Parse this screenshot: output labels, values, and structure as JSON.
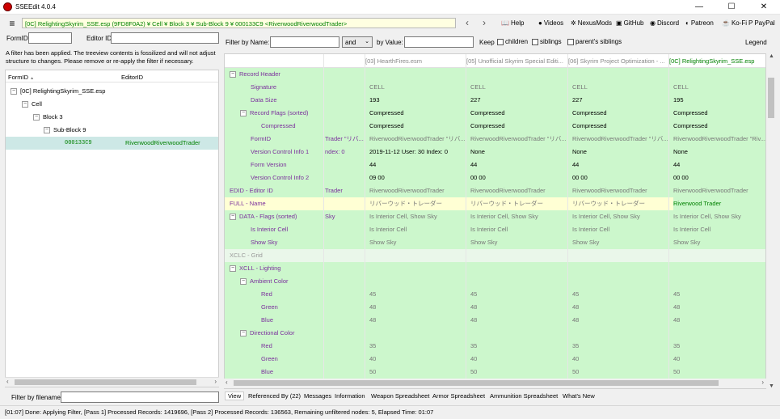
{
  "window": {
    "title": "SSEEdit 4.0.4",
    "min": "—",
    "max": "☐",
    "close": "✕"
  },
  "toolbar": {
    "path": "[0C] RelightingSkyrim_SSE.esp (9FD8F0A2) ¥ Cell ¥ Block 3 ¥ Sub-Block 9 ¥ 000133C9 <RiverwoodRiverwoodTrader>",
    "back": "‹",
    "forward": "›",
    "links": [
      {
        "label": "Help",
        "icon": "📖",
        "name": "help"
      },
      {
        "label": "Videos",
        "icon": "●",
        "name": "videos"
      },
      {
        "label": "NexusMods",
        "icon": "✲",
        "name": "nexusmods"
      },
      {
        "label": "GitHub",
        "icon": "▣",
        "name": "github"
      },
      {
        "label": "Discord",
        "icon": "◉",
        "name": "discord"
      },
      {
        "label": "Patreon",
        "icon": "◐",
        "name": "patreon"
      },
      {
        "label": "Ko-Fi",
        "icon": "☕",
        "name": "kofi"
      },
      {
        "label": "PayPal",
        "icon": "P",
        "name": "paypal"
      }
    ]
  },
  "left": {
    "formid_label": "FormID",
    "editorid_label": "Editor ID",
    "notice": "A filter has been applied. The treeview contents is fossilized and will not adjust structure to changes.  Please remove or re-apply the filter if necessary.",
    "col_formid": "FormID",
    "col_sort": "▲",
    "col_editorid": "EditorID",
    "tree": [
      {
        "label": "[0C] RelightingSkyrim_SSE.esp",
        "toggle": "−"
      },
      {
        "label": "Cell",
        "toggle": "−"
      },
      {
        "label": "Block 3",
        "toggle": "−"
      },
      {
        "label": "Sub-Block 9",
        "toggle": "−"
      }
    ],
    "selected": {
      "formid": "000133C9",
      "editorid": "RiverwoodRiverwoodTrader"
    },
    "filename_label": "Filter by filename:"
  },
  "filter": {
    "by_name": "Filter by Name:",
    "op": "and",
    "by_value": "by Value:",
    "keep": "Keep",
    "children": "children",
    "siblings": "siblings",
    "parents_siblings": "parent's siblings",
    "legend": "Legend"
  },
  "grid": {
    "columns": [
      "[03] HearthFires.esm",
      "[05] Unofficial Skyrim Special Editi...",
      "[06] Skyrim Project Optimization - ...",
      "[0C] RelightingSkyrim_SSE.esp"
    ],
    "rows": [
      {
        "label": "Record Header",
        "indent": 0,
        "tog": "−",
        "bg": "green",
        "c0": "",
        "v": [
          "",
          "",
          "",
          ""
        ]
      },
      {
        "label": "Signature",
        "indent": 2,
        "tog": "",
        "bg": "green",
        "c0": "",
        "v": [
          "CELL",
          "CELL",
          "CELL",
          "CELL"
        ],
        "grey": true
      },
      {
        "label": "Data Size",
        "indent": 2,
        "tog": "",
        "bg": "green",
        "c0": "",
        "v": [
          "193",
          "227",
          "227",
          "195"
        ]
      },
      {
        "label": "Record Flags (sorted)",
        "indent": 1,
        "tog": "−",
        "bg": "green",
        "c0": "",
        "v": [
          "Compressed",
          "Compressed",
          "Compressed",
          "Compressed"
        ]
      },
      {
        "label": "Compressed",
        "indent": 3,
        "tog": "",
        "bg": "green",
        "c0": "",
        "v": [
          "Compressed",
          "Compressed",
          "Compressed",
          "Compressed"
        ]
      },
      {
        "label": "FormID",
        "indent": 2,
        "tog": "",
        "bg": "green",
        "c0": "Trader \"リバ...",
        "v": [
          "RiverwoodRiverwoodTrader \"リバ...",
          "RiverwoodRiverwoodTrader \"リバ...",
          "RiverwoodRiverwoodTrader \"リバ...",
          "RiverwoodRiverwoodTrader \"Riv..."
        ],
        "grey": true
      },
      {
        "label": "Version Control Info 1",
        "indent": 2,
        "tog": "",
        "bg": "green",
        "c0": "ndex: 0",
        "v": [
          "2019-11-12 User: 30 Index: 0",
          "None",
          "None",
          "None"
        ]
      },
      {
        "label": "Form Version",
        "indent": 2,
        "tog": "",
        "bg": "green",
        "c0": "",
        "v": [
          "44",
          "44",
          "44",
          "44"
        ]
      },
      {
        "label": "Version Control Info 2",
        "indent": 2,
        "tog": "",
        "bg": "green",
        "c0": "",
        "v": [
          "09 00",
          "00 00",
          "00 00",
          "00 00"
        ]
      },
      {
        "label": "EDID - Editor ID",
        "indent": 0,
        "tog": "",
        "bg": "green",
        "c0": "Trader",
        "v": [
          "RiverwoodRiverwoodTrader",
          "RiverwoodRiverwoodTrader",
          "RiverwoodRiverwoodTrader",
          "RiverwoodRiverwoodTrader"
        ],
        "grey": true
      },
      {
        "label": "FULL - Name",
        "indent": 0,
        "tog": "",
        "bg": "yellow",
        "c0": "",
        "v": [
          "リバーウッド・トレーダー",
          "リバーウッド・トレーダー",
          "リバーウッド・トレーダー",
          "Riverwood Trader"
        ],
        "grey": true,
        "lastgreen": true
      },
      {
        "label": "DATA - Flags (sorted)",
        "indent": 0,
        "tog": "−",
        "bg": "green",
        "c0": "Sky",
        "v": [
          "Is Interior Cell, Show Sky",
          "Is Interior Cell, Show Sky",
          "Is Interior Cell, Show Sky",
          "Is Interior Cell, Show Sky"
        ],
        "grey": true
      },
      {
        "label": "Is Interior Cell",
        "indent": 2,
        "tog": "",
        "bg": "green",
        "c0": "",
        "v": [
          "Is Interior Cell",
          "Is Interior Cell",
          "Is Interior Cell",
          "Is Interior Cell"
        ],
        "grey": true
      },
      {
        "label": "Show Sky",
        "indent": 2,
        "tog": "",
        "bg": "green",
        "c0": "",
        "v": [
          "Show Sky",
          "Show Sky",
          "Show Sky",
          "Show Sky"
        ],
        "grey": true
      },
      {
        "label": "XCLC - Grid",
        "indent": 0,
        "tog": "",
        "bg": "pale",
        "c0": "",
        "v": [
          "",
          "",
          "",
          ""
        ],
        "greylabel": true
      },
      {
        "label": "XCLL - Lighting",
        "indent": 0,
        "tog": "−",
        "bg": "green",
        "c0": "",
        "v": [
          "",
          "",
          "",
          ""
        ]
      },
      {
        "label": "Ambient Color",
        "indent": 1,
        "tog": "−",
        "bg": "green",
        "c0": "",
        "v": [
          "",
          "",
          "",
          ""
        ]
      },
      {
        "label": "Red",
        "indent": 3,
        "tog": "",
        "bg": "green",
        "c0": "",
        "v": [
          "45",
          "45",
          "45",
          "45"
        ],
        "grey": true
      },
      {
        "label": "Green",
        "indent": 3,
        "tog": "",
        "bg": "green",
        "c0": "",
        "v": [
          "48",
          "48",
          "48",
          "48"
        ],
        "grey": true
      },
      {
        "label": "Blue",
        "indent": 3,
        "tog": "",
        "bg": "green",
        "c0": "",
        "v": [
          "48",
          "48",
          "48",
          "48"
        ],
        "grey": true
      },
      {
        "label": "Directional Color",
        "indent": 1,
        "tog": "−",
        "bg": "green",
        "c0": "",
        "v": [
          "",
          "",
          "",
          ""
        ]
      },
      {
        "label": "Red",
        "indent": 3,
        "tog": "",
        "bg": "green",
        "c0": "",
        "v": [
          "35",
          "35",
          "35",
          "35"
        ],
        "grey": true
      },
      {
        "label": "Green",
        "indent": 3,
        "tog": "",
        "bg": "green",
        "c0": "",
        "v": [
          "40",
          "40",
          "40",
          "40"
        ],
        "grey": true
      },
      {
        "label": "Blue",
        "indent": 3,
        "tog": "",
        "bg": "green",
        "c0": "",
        "v": [
          "50",
          "50",
          "50",
          "50"
        ],
        "grey": true
      }
    ]
  },
  "tabs": [
    "View",
    "Referenced By (22)",
    "Messages",
    "Information",
    "Weapon Spreadsheet",
    "Armor Spreadsheet",
    "Ammunition Spreadsheet",
    "What's New"
  ],
  "status": "[01:07] Done: Applying Filter, [Pass 1] Processed Records: 1419696, [Pass 2] Processed Records: 136563, Remaining unfiltered nodes: 5, Elapsed Time: 01:07",
  "colors": {
    "green_row": "#ccf7cc",
    "yellow_row": "#ffffd4",
    "label_purple": "#7a2e9c",
    "path_green": "#008000"
  }
}
